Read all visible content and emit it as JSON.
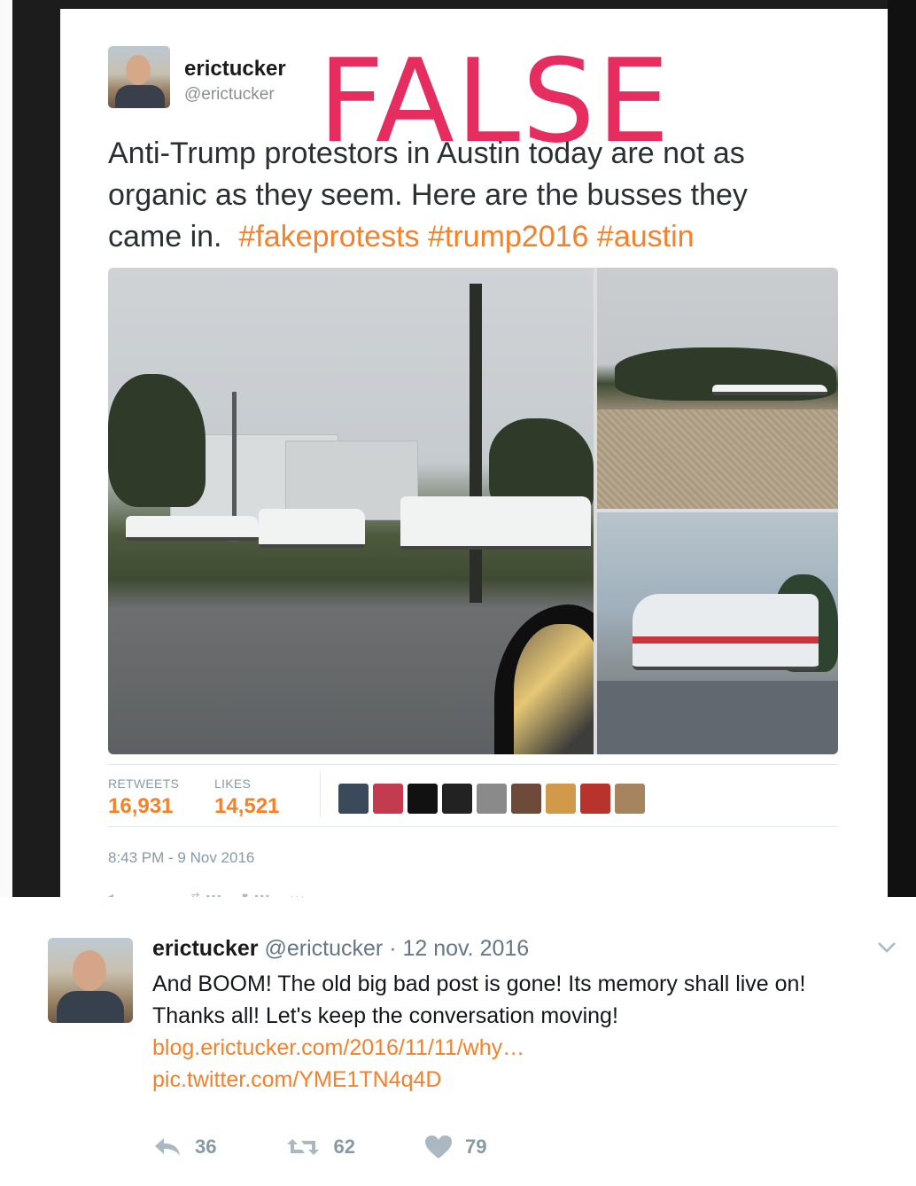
{
  "tweet1": {
    "name": "erictucker",
    "handle": "@erictucker",
    "stamp": "FALSE",
    "text_line1": "Anti-Trump protestors in Austin today are not as",
    "text_line2": "organic as they seem.  Here are the busses they",
    "text_line3_plain": "came in.",
    "hashtags": [
      "#fakeprotests",
      "#trump2016",
      "#austin"
    ],
    "retweets_label": "RETWEETS",
    "retweets_value": "16,931",
    "likes_label": "LIKES",
    "likes_value": "14,521",
    "timestamp": "8:43 PM - 9 Nov 2016",
    "liker_colors": [
      "#3b4a5a",
      "#c23b4e",
      "#111111",
      "#222222",
      "#8a8a8a",
      "#6e4a3a",
      "#d19a4a",
      "#b8332c",
      "#a5845f"
    ]
  },
  "tweet2": {
    "name": "erictucker",
    "handle": "@erictucker",
    "dot": "·",
    "date": "12 nov. 2016",
    "text": "And BOOM!  The old big bad post is gone!  Its memory shall live on!  Thanks all! Let's keep the conversation moving!",
    "link1": "blog.erictucker.com/2016/11/11/why…",
    "link2": "pic.twitter.com/YME1TN4q4D",
    "replies": "36",
    "retweets": "62",
    "likes": "79",
    "caret_icon": "chevron-down-icon"
  },
  "colors": {
    "accent": "#f5812a",
    "stamp": "#e4255a"
  }
}
